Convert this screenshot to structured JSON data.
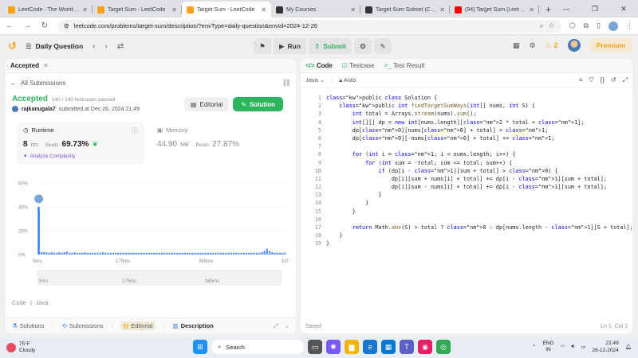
{
  "browser": {
    "tabs": [
      {
        "title": "LeetCode - The World's Le...",
        "color": "#ffa116",
        "active": false
      },
      {
        "title": "Target Sum - LeetCode",
        "color": "#ffa116",
        "active": false
      },
      {
        "title": "Target Sum - LeetCode",
        "color": "#ffa116",
        "active": true
      },
      {
        "title": "My Courses",
        "color": "#333333",
        "active": false
      },
      {
        "title": "Target Sum Subset (Code)",
        "color": "#333333",
        "active": false
      },
      {
        "title": "(94) Target Sum (LeetCode...",
        "color": "#ff0000",
        "active": false
      }
    ],
    "new_tab": "+",
    "url": "leetcode.com/problems/target-sum/description/?envType=daily-question&envId=2024-12-26"
  },
  "lcnav": {
    "page": "Daily Question",
    "run": "Run",
    "submit": "Submit",
    "streak": "2",
    "premium": "Premium"
  },
  "left": {
    "tab": "Accepted",
    "back": "All Submissions",
    "status": "Accepted",
    "passed": "140 / 140 testcases passed",
    "author": "rajkanugala7",
    "submitted": "submitted at Dec 26, 2024 21:49",
    "editorial_btn": "Editorial",
    "solution_btn": "Solution",
    "runtime": {
      "label": "Runtime",
      "value": "8",
      "unit": "ms",
      "beats_label": "Beats",
      "beats": "69.73%",
      "analyze": "Analyze Complexity"
    },
    "memory": {
      "label": "Memory",
      "value": "44.90",
      "unit": "MB",
      "beats_label": "Beats",
      "beats": "27.87%"
    },
    "lang_label": "Code",
    "lang": "Java",
    "bottom": {
      "solutions": "Solutions",
      "submissions": "Submissions",
      "editorial": "Editorial",
      "description": "Description"
    }
  },
  "chart_data": {
    "type": "bar",
    "yticks": [
      "60%",
      "40%",
      "20%",
      "0%"
    ],
    "ylim": [
      0,
      60
    ],
    "xticks": [
      "5ms",
      "175ms",
      "345ms",
      "515ms"
    ],
    "highlight_index": 0,
    "values": [
      40,
      2,
      2,
      2,
      1.5,
      2,
      1.5,
      1.5,
      2,
      1.5,
      2,
      2.5,
      1.5,
      1.5,
      2,
      1.5,
      1.5,
      1.5,
      2,
      1.5,
      1.5,
      1.5,
      1.5,
      1.5,
      1.5,
      2,
      1.5,
      1.5,
      1.5,
      1.5,
      1.5,
      1.5,
      1.5,
      1.5,
      1.5,
      1.5,
      1.5,
      1.5,
      1.5,
      1.5,
      1.5,
      1.5,
      1.5,
      1.5,
      1.5,
      1.5,
      1.5,
      1.5,
      1.5,
      1.5,
      1.5,
      1.5,
      1.5,
      1.5,
      1.5,
      1.5,
      1.5,
      1.5,
      1.5,
      1.5,
      1.5,
      1.5,
      1.5,
      1.5,
      1.5,
      1.5,
      1.5,
      1.5,
      1.5,
      1.5,
      1.5,
      1.5,
      1.5,
      1.5,
      1.5,
      1.5,
      1.5,
      1.5,
      1.5,
      1.5,
      1.5,
      1.5,
      1.5,
      1.5,
      1.5,
      1.5,
      1.5,
      2,
      3,
      5,
      3,
      2,
      1.5,
      1.5,
      1.5,
      1.5,
      1.5
    ],
    "bar_color": "#2a73ff",
    "mini_xticks": [
      "5ms",
      "175ms",
      "345ms",
      "515ms"
    ]
  },
  "right": {
    "tabs": {
      "code": "Code",
      "testcase": "Testcase",
      "result": "Test Result"
    },
    "language": "Java",
    "autosave": "Auto",
    "saved": "Saved",
    "cursor": "Ln 1, Col 1"
  },
  "code_lines": [
    "public class Solution {",
    "    public int findTargetSumWays(int[] nums, int S) {",
    "        int total = Arrays.stream(nums).sum();",
    "        int[][] dp = new int[nums.length][2 * total + 1];",
    "        dp[0][nums[0] + total] = 1;",
    "        dp[0][-nums[0] + total] += 1;",
    "",
    "        for (int i = 1; i < nums.length; i++) {",
    "            for (int sum = -total; sum <= total; sum++) {",
    "                if (dp[i - 1][sum + total] > 0) {",
    "                    dp[i][sum + nums[i] + total] += dp[i - 1][sum + total];",
    "                    dp[i][sum - nums[i] + total] += dp[i - 1][sum + total];",
    "                }",
    "            }",
    "        }",
    "",
    "        return Math.abs(S) > total ? 0 : dp[nums.length - 1][S + total];",
    "    }",
    "}"
  ],
  "taskbar": {
    "temp": "75°F",
    "weather": "Cloudy",
    "search": "Search",
    "lang1": "ENG",
    "lang2": "IN",
    "time": "21:49",
    "date": "26-12-2024"
  }
}
